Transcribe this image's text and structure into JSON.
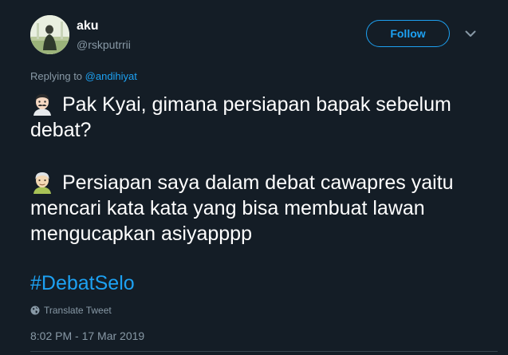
{
  "user": {
    "display_name": "aku",
    "handle": "@rskputrrii"
  },
  "follow_label": "Follow",
  "reply": {
    "prefix": "Replying to ",
    "mention": "@andihiyat"
  },
  "tweet": {
    "line1": "Pak Kyai, gimana persiapan bapak sebelum debat?",
    "line2": "Persiapan saya dalam debat cawapres yaitu mencari kata kata yang bisa membuat lawan mengucapkan asiyapppp",
    "emoji1": "man-mustache-emoji",
    "emoji2": "old-man-emoji",
    "hashtag": "#DebatSelo"
  },
  "translate_label": "Translate Tweet",
  "timestamp": "8:02 PM - 17 Mar 2019",
  "colors": {
    "background": "#141d26",
    "accent": "#1da1f2",
    "muted": "#8899a6",
    "divider": "#38444d"
  }
}
